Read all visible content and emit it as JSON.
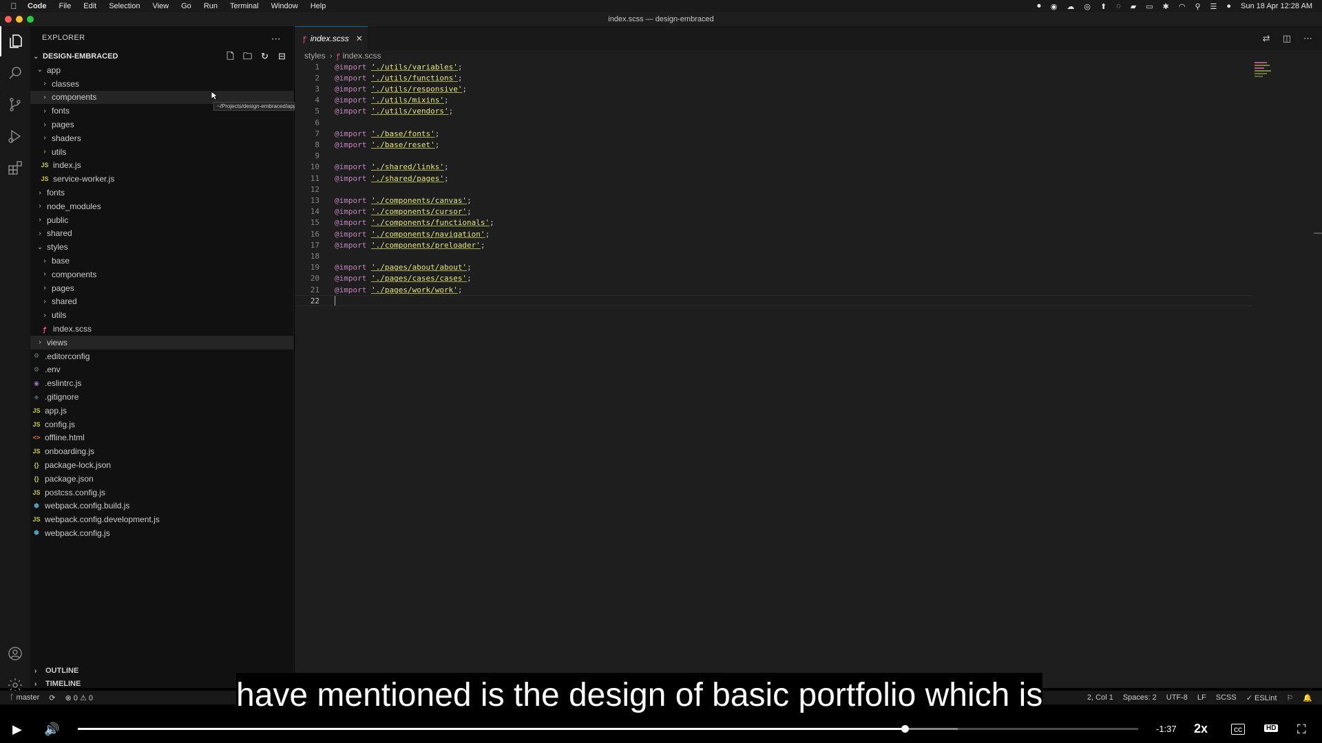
{
  "menubar": {
    "app_name": "Code",
    "items": [
      "File",
      "Edit",
      "Selection",
      "View",
      "Go",
      "Run",
      "Terminal",
      "Window",
      "Help"
    ],
    "clock": "Sun 18 Apr  12:28 AM"
  },
  "window": {
    "title": "index.scss — design-embraced"
  },
  "explorer": {
    "title": "EXPLORER",
    "project": "DESIGN-EMBRACED",
    "tree": [
      {
        "label": "app",
        "type": "folder",
        "depth": 0,
        "open": true
      },
      {
        "label": "classes",
        "type": "folder",
        "depth": 1,
        "open": false
      },
      {
        "label": "components",
        "type": "folder",
        "depth": 1,
        "open": false,
        "hover": true
      },
      {
        "label": "fonts",
        "type": "folder",
        "depth": 1,
        "open": false
      },
      {
        "label": "pages",
        "type": "folder",
        "depth": 1,
        "open": false
      },
      {
        "label": "shaders",
        "type": "folder",
        "depth": 1,
        "open": false
      },
      {
        "label": "utils",
        "type": "folder",
        "depth": 1,
        "open": false
      },
      {
        "label": "index.js",
        "type": "js",
        "depth": 1
      },
      {
        "label": "service-worker.js",
        "type": "js",
        "depth": 1
      },
      {
        "label": "fonts",
        "type": "folder",
        "depth": 0,
        "open": false
      },
      {
        "label": "node_modules",
        "type": "folder",
        "depth": 0,
        "open": false
      },
      {
        "label": "public",
        "type": "folder",
        "depth": 0,
        "open": false
      },
      {
        "label": "shared",
        "type": "folder",
        "depth": 0,
        "open": false
      },
      {
        "label": "styles",
        "type": "folder",
        "depth": 0,
        "open": true
      },
      {
        "label": "base",
        "type": "folder",
        "depth": 1,
        "open": false
      },
      {
        "label": "components",
        "type": "folder",
        "depth": 1,
        "open": false
      },
      {
        "label": "pages",
        "type": "folder",
        "depth": 1,
        "open": false
      },
      {
        "label": "shared",
        "type": "folder",
        "depth": 1,
        "open": false
      },
      {
        "label": "utils",
        "type": "folder",
        "depth": 1,
        "open": false
      },
      {
        "label": "index.scss",
        "type": "scss",
        "depth": 1
      },
      {
        "label": "views",
        "type": "folder",
        "depth": 0,
        "open": false,
        "selected": true
      },
      {
        "label": ".editorconfig",
        "type": "cfg",
        "depth": 0
      },
      {
        "label": ".env",
        "type": "cfg",
        "depth": 0
      },
      {
        "label": ".eslintrc.js",
        "type": "eslint",
        "depth": 0
      },
      {
        "label": ".gitignore",
        "type": "git",
        "depth": 0
      },
      {
        "label": "app.js",
        "type": "js",
        "depth": 0
      },
      {
        "label": "config.js",
        "type": "js",
        "depth": 0
      },
      {
        "label": "offline.html",
        "type": "html",
        "depth": 0
      },
      {
        "label": "onboarding.js",
        "type": "js",
        "depth": 0
      },
      {
        "label": "package-lock.json",
        "type": "json",
        "depth": 0
      },
      {
        "label": "package.json",
        "type": "json",
        "depth": 0
      },
      {
        "label": "postcss.config.js",
        "type": "js",
        "depth": 0
      },
      {
        "label": "webpack.config.build.js",
        "type": "webpack",
        "depth": 0
      },
      {
        "label": "webpack.config.development.js",
        "type": "js",
        "depth": 0
      },
      {
        "label": "webpack.config.js",
        "type": "webpack",
        "depth": 0
      }
    ],
    "tooltip": "~/Projects/design-embraced/app/components",
    "outline": "OUTLINE",
    "timeline": "TIMELINE"
  },
  "editor": {
    "tab_label": "index.scss",
    "breadcrumb": [
      "styles",
      "index.scss"
    ],
    "lines": [
      {
        "n": "1",
        "kw": "@import",
        "str": "'./utils/variables'",
        "end": ";"
      },
      {
        "n": "2",
        "kw": "@import",
        "str": "'./utils/functions'",
        "end": ";"
      },
      {
        "n": "3",
        "kw": "@import",
        "str": "'./utils/responsive'",
        "end": ";"
      },
      {
        "n": "4",
        "kw": "@import",
        "str": "'./utils/mixins'",
        "end": ";"
      },
      {
        "n": "5",
        "kw": "@import",
        "str": "'./utils/vendors'",
        "end": ";"
      },
      {
        "n": "6",
        "kw": "",
        "str": "",
        "end": ""
      },
      {
        "n": "7",
        "kw": "@import",
        "str": "'./base/fonts'",
        "end": ";"
      },
      {
        "n": "8",
        "kw": "@import",
        "str": "'./base/reset'",
        "end": ";"
      },
      {
        "n": "9",
        "kw": "",
        "str": "",
        "end": ""
      },
      {
        "n": "10",
        "kw": "@import",
        "str": "'./shared/links'",
        "end": ";"
      },
      {
        "n": "11",
        "kw": "@import",
        "str": "'./shared/pages'",
        "end": ";"
      },
      {
        "n": "12",
        "kw": "",
        "str": "",
        "end": ""
      },
      {
        "n": "13",
        "kw": "@import",
        "str": "'./components/canvas'",
        "end": ";"
      },
      {
        "n": "14",
        "kw": "@import",
        "str": "'./components/cursor'",
        "end": ";"
      },
      {
        "n": "15",
        "kw": "@import",
        "str": "'./components/functionals'",
        "end": ";"
      },
      {
        "n": "16",
        "kw": "@import",
        "str": "'./components/navigation'",
        "end": ";"
      },
      {
        "n": "17",
        "kw": "@import",
        "str": "'./components/preloader'",
        "end": ";"
      },
      {
        "n": "18",
        "kw": "",
        "str": "",
        "end": ""
      },
      {
        "n": "19",
        "kw": "@import",
        "str": "'./pages/about/about'",
        "end": ";"
      },
      {
        "n": "20",
        "kw": "@import",
        "str": "'./pages/cases/cases'",
        "end": ";"
      },
      {
        "n": "21",
        "kw": "@import",
        "str": "'./pages/work/work'",
        "end": ";"
      },
      {
        "n": "22",
        "kw": "",
        "str": "",
        "end": "",
        "current": true
      }
    ]
  },
  "statusbar": {
    "branch": "master",
    "problems": "⊗ 0 ⚠ 0",
    "position": "2, Col 1",
    "spaces": "Spaces: 2",
    "encoding": "UTF-8",
    "eol": "LF",
    "language": "SCSS",
    "linter": "✓ ESLint"
  },
  "subtitle": "have mentioned is the design of basic portfolio which is",
  "player": {
    "time_remaining": "-1:37",
    "speed": "2x",
    "progress": 0.78,
    "buffered": 0.83
  }
}
